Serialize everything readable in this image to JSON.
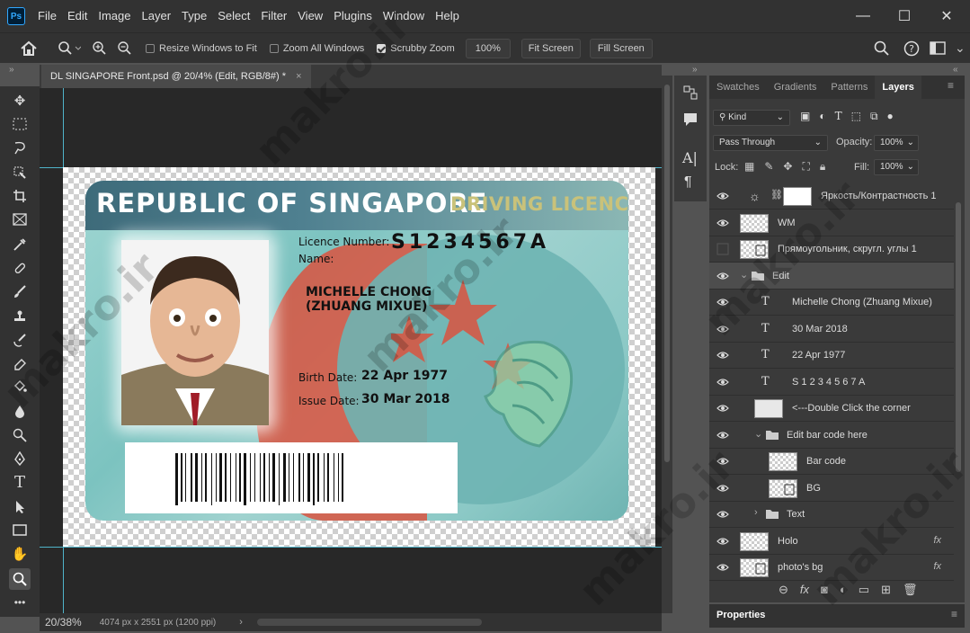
{
  "app": {
    "logo": "Ps"
  },
  "menu": [
    "File",
    "Edit",
    "Image",
    "Layer",
    "Type",
    "Select",
    "Filter",
    "View",
    "Plugins",
    "Window",
    "Help"
  ],
  "window_controls": {
    "minimize": "—",
    "maximize": "☐",
    "close": "✕"
  },
  "options": {
    "resize_windows": "Resize Windows to Fit",
    "zoom_all": "Zoom All Windows",
    "scrubby_zoom": "Scrubby Zoom",
    "zoom_value": "100%",
    "fit_screen": "Fit Screen",
    "fill_screen": "Fill Screen"
  },
  "document": {
    "tab_title": "DL SINGAPORE Front.psd @ 20/4% (Edit, RGB/8#) *",
    "tab_close": "×"
  },
  "card": {
    "header_left": "REPUBLIC OF SINGAPORE",
    "header_right": "DRIVING LICENCE",
    "licence_label": "Licence Number:",
    "licence_number": "S1234567A",
    "name_label": "Name:",
    "name_line1": "MICHELLE CHONG",
    "name_line2": "(ZHUANG MIXUE)",
    "birth_label": "Birth Date:",
    "birth_value": "22 Apr 1977",
    "issue_label": "Issue Date:",
    "issue_value": "30 Mar 2018"
  },
  "status": {
    "zoom": "20/38%",
    "size": "4074 px x 2551 px (1200 ppi)",
    "arrow": "›"
  },
  "panel": {
    "tabs": [
      "Swatches",
      "Gradients",
      "Patterns",
      "Layers"
    ],
    "active_tab": "Layers",
    "filter_kind": "Kind",
    "blend_mode": "Pass Through",
    "opacity_label": "Opacity:",
    "opacity_value": "100%",
    "lock_label": "Lock:",
    "fill_label": "Fill:",
    "fill_value": "100%",
    "properties": "Properties"
  },
  "layers": [
    {
      "name": "Яркость/Контрастность 1",
      "kind": "adjustment",
      "visible": true
    },
    {
      "name": "WM",
      "kind": "pixel",
      "visible": true
    },
    {
      "name": "Прямоугольник, скругл. углы 1",
      "kind": "shape",
      "visible": false
    },
    {
      "name": "Edit",
      "kind": "group-open",
      "visible": true
    },
    {
      "name": "Michelle Chong (Zhuang Mixue)",
      "kind": "text",
      "visible": true
    },
    {
      "name": "30 Mar 2018",
      "kind": "text",
      "visible": true
    },
    {
      "name": "22 Apr 1977",
      "kind": "text",
      "visible": true
    },
    {
      "name": "S 1 2 3 4 5 6 7 A",
      "kind": "text",
      "visible": true
    },
    {
      "name": "<---Double Click the corner",
      "kind": "smart",
      "visible": true
    },
    {
      "name": "Edit bar code here",
      "kind": "group-open",
      "visible": true
    },
    {
      "name": "Bar code",
      "kind": "pixel",
      "visible": true
    },
    {
      "name": "BG",
      "kind": "shape",
      "visible": true
    },
    {
      "name": "Text",
      "kind": "group-closed",
      "visible": true
    },
    {
      "name": "Holo",
      "kind": "pixel",
      "visible": true,
      "fx": "fx"
    },
    {
      "name": "photo's bg",
      "kind": "shape",
      "visible": true,
      "fx": "fx"
    }
  ],
  "watermark": "makro.ir"
}
